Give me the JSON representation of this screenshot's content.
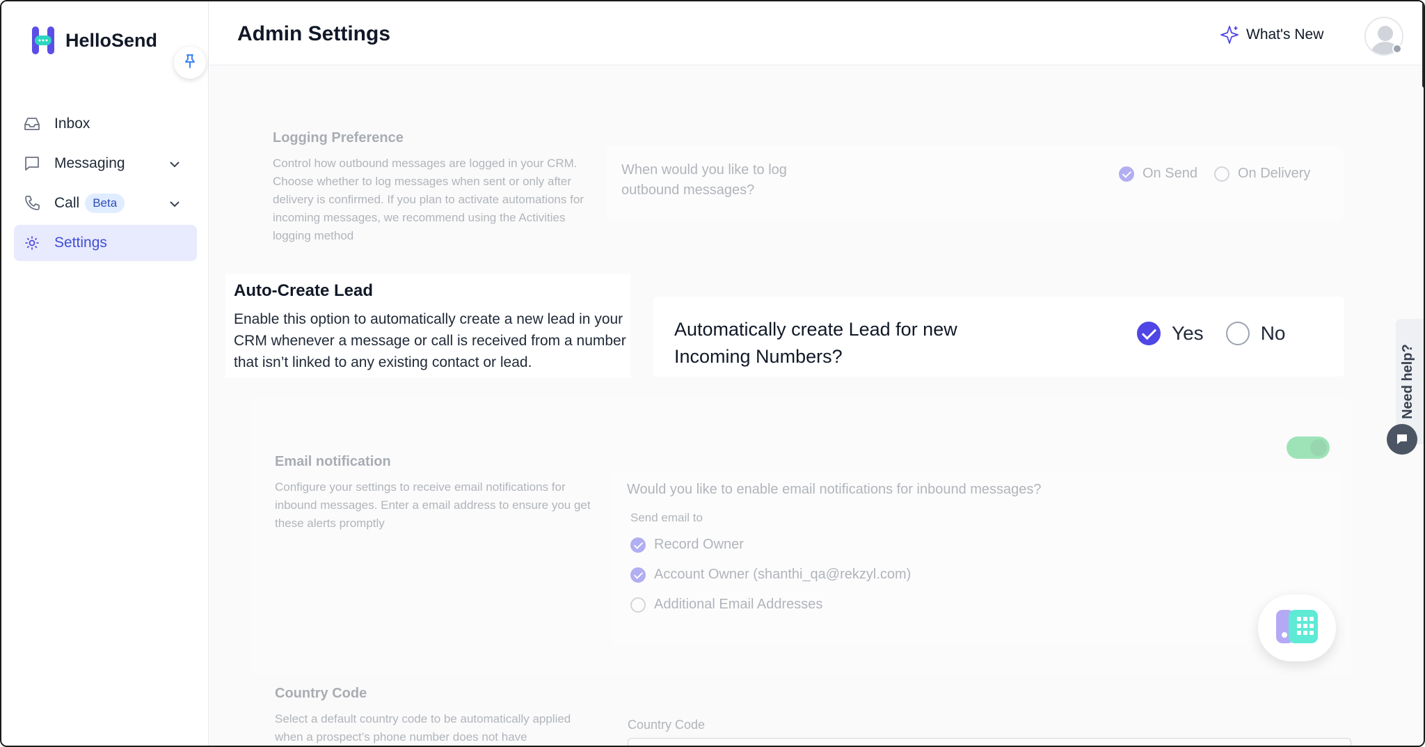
{
  "app": {
    "name": "HelloSend"
  },
  "sidebar": {
    "items": [
      {
        "label": "Inbox"
      },
      {
        "label": "Messaging"
      },
      {
        "label": "Call",
        "badge": "Beta"
      },
      {
        "label": "Settings"
      }
    ]
  },
  "header": {
    "title": "Admin Settings",
    "whats_new": "What's New"
  },
  "logging": {
    "title": "Logging Preference",
    "description": "Control how outbound messages are logged in your CRM. Choose whether to log messages when sent or only after delivery is confirmed. If you plan to activate automations for incoming messages, we recommend using the Activities logging method",
    "question": "When would you like to log outbound messages?",
    "options": [
      {
        "label": "On Send",
        "checked": true
      },
      {
        "label": "On Delivery",
        "checked": false
      }
    ]
  },
  "auto_lead": {
    "title": "Auto-Create Lead",
    "description": "Enable this option to automatically create a new lead in your CRM whenever a message or call is received from a number that isn’t linked to any existing contact or lead.",
    "question": "Automatically create Lead for new Incoming Numbers?",
    "options": [
      {
        "label": "Yes",
        "checked": true
      },
      {
        "label": "No",
        "checked": false
      }
    ]
  },
  "email_notification": {
    "title": "Email notification",
    "description": "Configure your settings to receive email notifications for inbound messages. Enter a email address to ensure you get these alerts promptly",
    "question": "Would you like to enable email notifications for inbound messages?",
    "send_to_label": "Send email to",
    "enabled": true,
    "recipients": [
      {
        "label": "Record Owner",
        "checked": true
      },
      {
        "label": "Account Owner (shanthi_qa@rekzyl.com)",
        "checked": true
      },
      {
        "label": "Additional Email Addresses",
        "checked": false
      }
    ]
  },
  "country_code": {
    "title": "Country Code",
    "description": "Select a default country code to be automatically applied when a prospect’s phone number does not have",
    "field_label": "Country Code"
  },
  "help": {
    "label": "Need help?"
  },
  "colors": {
    "accent": "#4f46e5",
    "active_bg": "#e8eafd",
    "toggle": "#22c55e"
  }
}
